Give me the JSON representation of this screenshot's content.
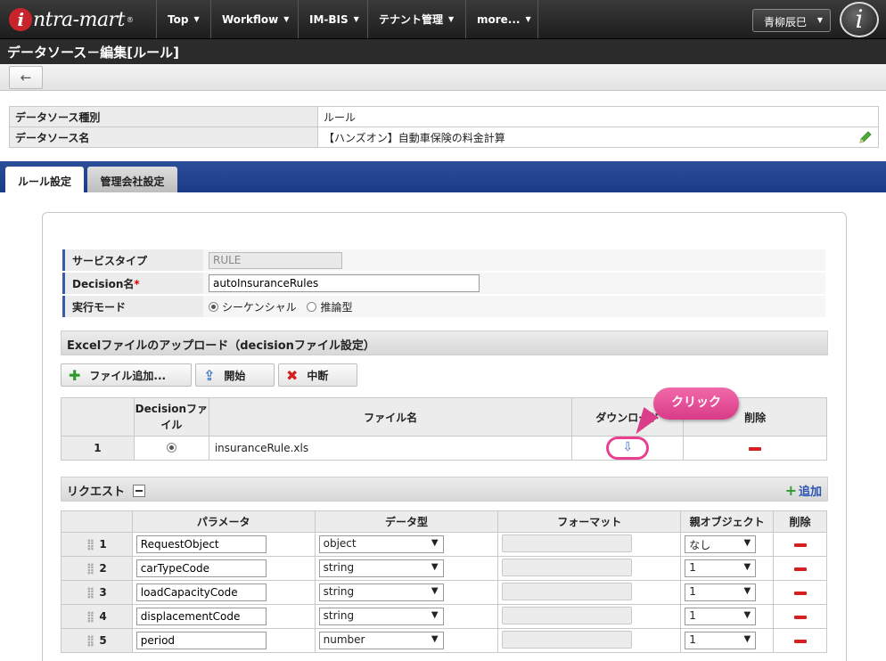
{
  "nav": {
    "logo_initial": "i",
    "logo_text": "ntra-mart",
    "logo_reg": "®",
    "items": [
      {
        "label": "Top"
      },
      {
        "label": "Workflow"
      },
      {
        "label": "IM-BIS"
      },
      {
        "label": "テナント管理"
      },
      {
        "label": "more..."
      }
    ],
    "caret": "▼",
    "user": "青柳辰巳",
    "info_icon": "i"
  },
  "page": {
    "title": "データソース－編集[ルール]",
    "back_icon": "←"
  },
  "info": {
    "rows": [
      {
        "label": "データソース種別",
        "value": "ルール"
      },
      {
        "label": "データソース名",
        "value": "【ハンズオン】自動車保険の料金計算"
      }
    ]
  },
  "tabs": [
    {
      "label": "ルール設定",
      "active": true
    },
    {
      "label": "管理会社設定",
      "active": false
    }
  ],
  "form": {
    "service_type_label": "サービスタイプ",
    "service_type_value": "RULE",
    "decision_label": "Decision名",
    "required_mark": "*",
    "decision_value": "autoInsuranceRules",
    "mode_label": "実行モード",
    "mode_options": [
      "シーケンシャル",
      "推論型"
    ],
    "mode_selected": "シーケンシャル"
  },
  "upload": {
    "section_title": "Excelファイルのアップロード（decisionファイル設定）",
    "buttons": [
      {
        "label": "ファイル追加...",
        "icon": "plus-icon",
        "glyph": "✚",
        "color": "#2c9a2c"
      },
      {
        "label": "開始",
        "icon": "upload-icon",
        "glyph": "⇪",
        "color": "#3c77c8"
      },
      {
        "label": "中断",
        "icon": "cancel-icon",
        "glyph": "✖",
        "color": "#d52020"
      }
    ],
    "headers": [
      "",
      "Decisionファイル",
      "ファイル名",
      "ダウンロード",
      "削除"
    ],
    "rows": [
      {
        "no": "1",
        "file": "insuranceRule.xls"
      }
    ],
    "download_glyph": "⇩",
    "callout": "クリック"
  },
  "request": {
    "section_title": "リクエスト",
    "add_label": "追加",
    "headers": [
      "",
      "パラメータ",
      "データ型",
      "フォーマット",
      "親オブジェクト",
      "削除"
    ],
    "drag_glyph": "⣿",
    "arrow": "▼",
    "rows": [
      {
        "no": "1",
        "param": "RequestObject",
        "type": "object",
        "parent": "なし"
      },
      {
        "no": "2",
        "param": "carTypeCode",
        "type": "string",
        "parent": "1"
      },
      {
        "no": "3",
        "param": "loadCapacityCode",
        "type": "string",
        "parent": "1"
      },
      {
        "no": "4",
        "param": "displacementCode",
        "type": "string",
        "parent": "1"
      },
      {
        "no": "5",
        "param": "period",
        "type": "number",
        "parent": "1"
      }
    ]
  }
}
